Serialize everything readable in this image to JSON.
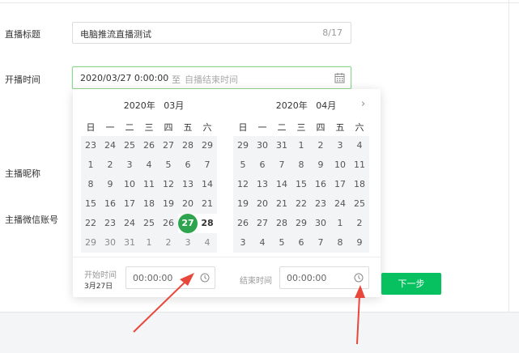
{
  "form": {
    "title_label": "直播标题",
    "title_value": "电脑推流直播测试",
    "title_count": "8/17",
    "time_label": "开播时间",
    "start_value": "2020/03/27 0:00:00",
    "to_text": "至",
    "end_placeholder": "自播结束时间",
    "nickname_label": "主播昵称",
    "wechat_label": "主播微信账号"
  },
  "picker": {
    "weekdays": [
      "日",
      "一",
      "二",
      "三",
      "四",
      "五",
      "六"
    ],
    "left": {
      "header": "2020年   03月",
      "days": [
        "23",
        "24",
        "25",
        "26",
        "27",
        "28",
        "29",
        "1",
        "2",
        "3",
        "4",
        "5",
        "6",
        "7",
        "8",
        "9",
        "10",
        "11",
        "12",
        "13",
        "14",
        "15",
        "16",
        "17",
        "18",
        "19",
        "20",
        "21",
        "22",
        "23",
        "24",
        "25",
        "26",
        "27",
        "28",
        "29",
        "30",
        "31",
        "1",
        "2",
        "3",
        "4"
      ]
    },
    "right": {
      "header": "2020年   04月",
      "days": [
        "29",
        "30",
        "31",
        "1",
        "2",
        "3",
        "4",
        "5",
        "6",
        "7",
        "8",
        "9",
        "10",
        "11",
        "12",
        "13",
        "14",
        "15",
        "16",
        "17",
        "18",
        "19",
        "20",
        "21",
        "22",
        "23",
        "24",
        "25",
        "26",
        "27",
        "28",
        "29",
        "30",
        "1",
        "2",
        "3",
        "4",
        "5",
        "6",
        "7",
        "8",
        "9"
      ]
    },
    "selected_day": "27",
    "start_label": "开始时间",
    "start_date": "3月27日",
    "start_time": "00:00:00",
    "end_label": "结束时间",
    "end_time": "00:00:00"
  },
  "next_step_label": "下一步",
  "icons": [
    "calendar-icon",
    "chevron-right-icon",
    "clock-icon"
  ],
  "colors": {
    "accent": "#07c160",
    "selected": "#2ea44f",
    "arrow": "#e8473c"
  }
}
